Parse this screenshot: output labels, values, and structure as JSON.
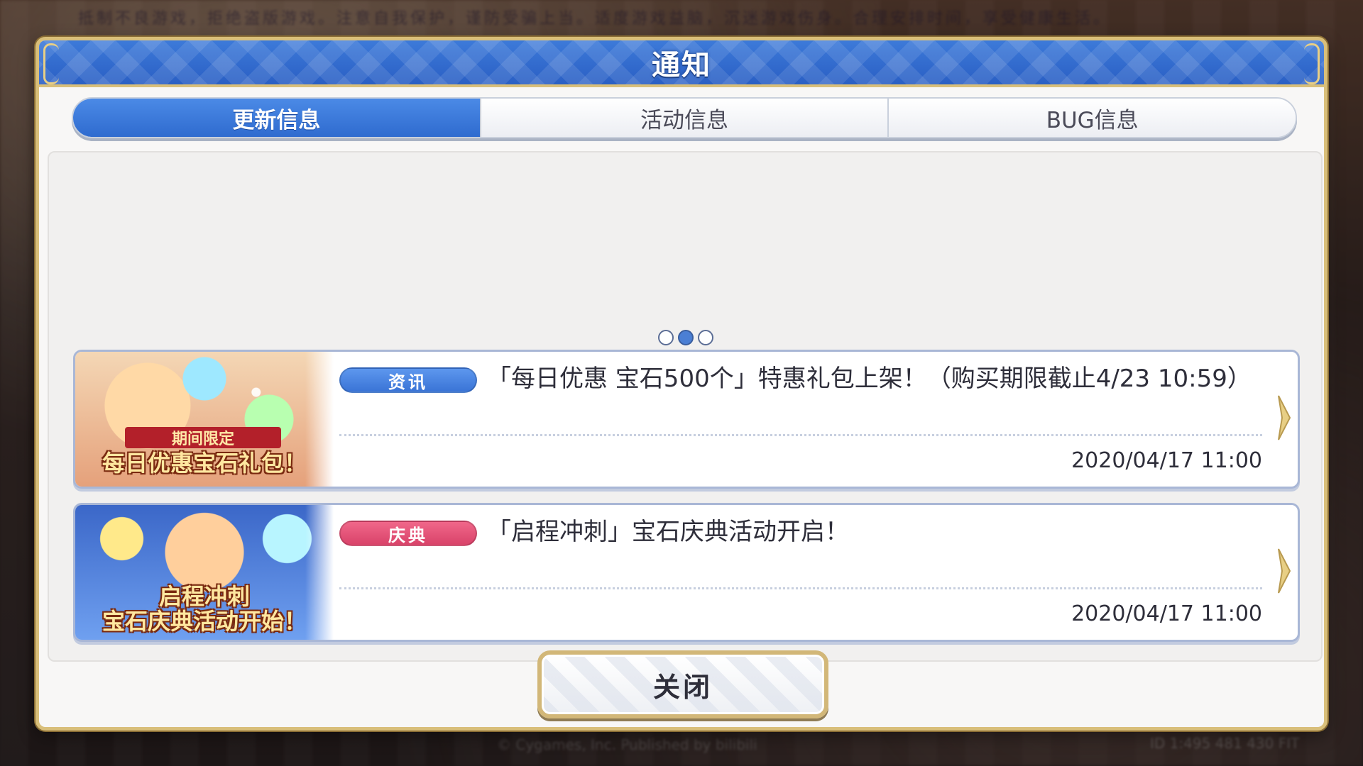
{
  "background": {
    "top_text": "抵制不良游戏，拒绝盗版游戏。注意自我保护，谨防受骗上当。适度游戏益脑，沉迷游戏伤身。合理安排时间，享受健康生活。",
    "bottom_text": "© Cygames, Inc. Published by bilibili",
    "bottom_right_text": "ID 1:495 481 430 FIT"
  },
  "dialog": {
    "title": "通知",
    "tabs": [
      {
        "label": "更新信息",
        "active": true
      },
      {
        "label": "活动信息",
        "active": false
      },
      {
        "label": "BUG信息",
        "active": false
      }
    ],
    "pager": {
      "count": 3,
      "active_index": 1
    },
    "news": [
      {
        "thumb_ribbon": "期间限定",
        "thumb_caption": "每日优惠宝石礼包！",
        "badge": "资讯",
        "badge_color": "#3a74d6",
        "title": "「每日优惠 宝石500个」特惠礼包上架！（购买期限截止4/23 10:59）",
        "date": "2020/04/17 11:00"
      },
      {
        "thumb_ribbon": "",
        "thumb_caption": "启程冲刺\n宝石庆典活动开始！",
        "badge": "庆典",
        "badge_color": "#d9436a",
        "title": "「启程冲刺」宝石庆典活动开启！",
        "date": "2020/04/17 11:00"
      }
    ],
    "close_label": "关闭"
  },
  "colors": {
    "title_bar": "#2a5fc4",
    "gold_frame": "#d9bf7a",
    "tab_active": "#2f6bcf",
    "badge_info": "#3a74d6",
    "badge_event": "#d9436a"
  },
  "icons": {
    "news_arrow": "chevron-right-icon",
    "pager_dot": "page-dot-icon"
  }
}
